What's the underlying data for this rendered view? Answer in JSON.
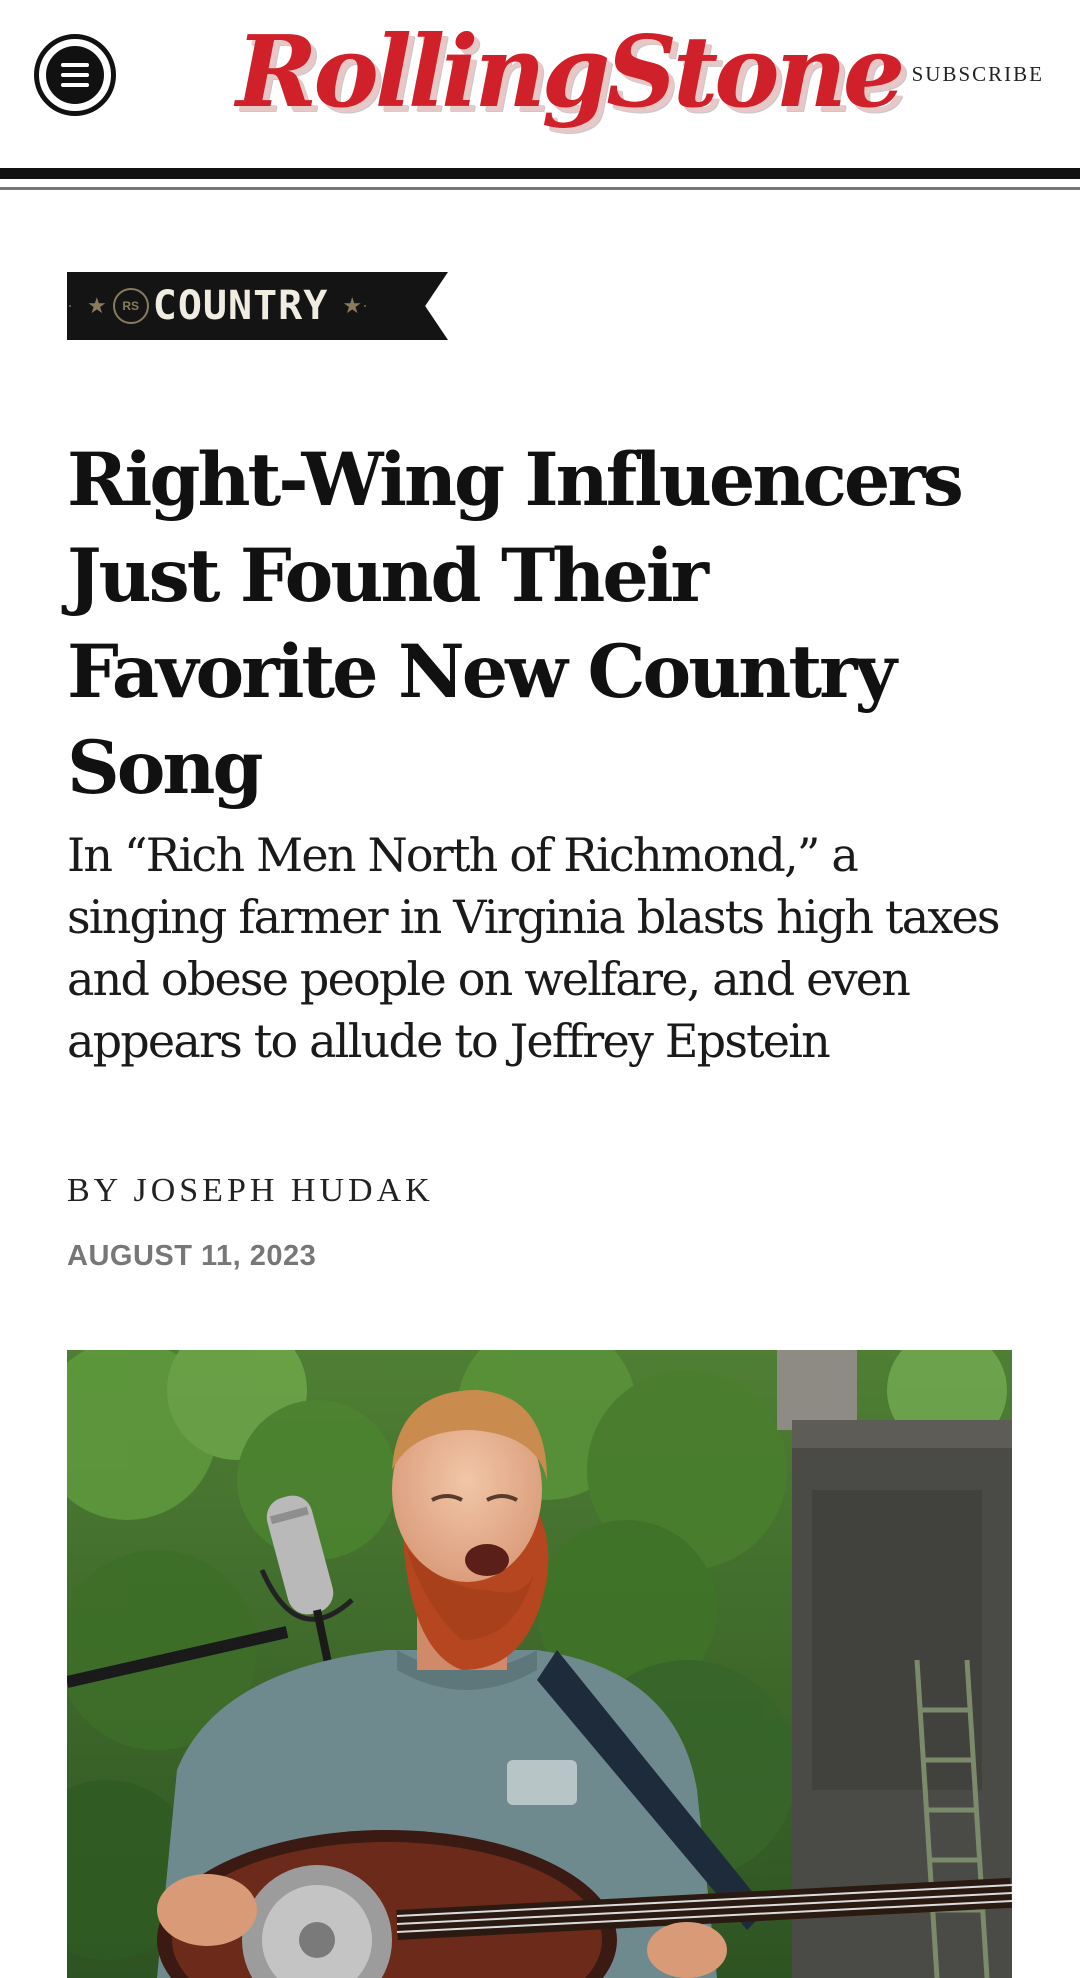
{
  "header": {
    "brand": "RollingStone",
    "subscribe_label": "SUBSCRIBE",
    "menu_icon": "hamburger-menu-icon",
    "brand_color": "#d0202a"
  },
  "article": {
    "category": "COUNTRY",
    "category_badge": "RS",
    "headline": "Right-Wing Influencers Just Found Their Favorite New Country Song",
    "dek": "In “Rich Men North of Richmond,” a singing farmer in Virginia blasts high taxes and obese people on welfare, and even appears to allude to Jeffrey Epstein",
    "byline_prefix": "BY",
    "author": "JOSEPH HUDAK",
    "date": "AUGUST 11, 2023",
    "hero_image": "photo of a red-bearded man singing and playing a resonator guitar outdoors in front of trees, with a microphone"
  }
}
